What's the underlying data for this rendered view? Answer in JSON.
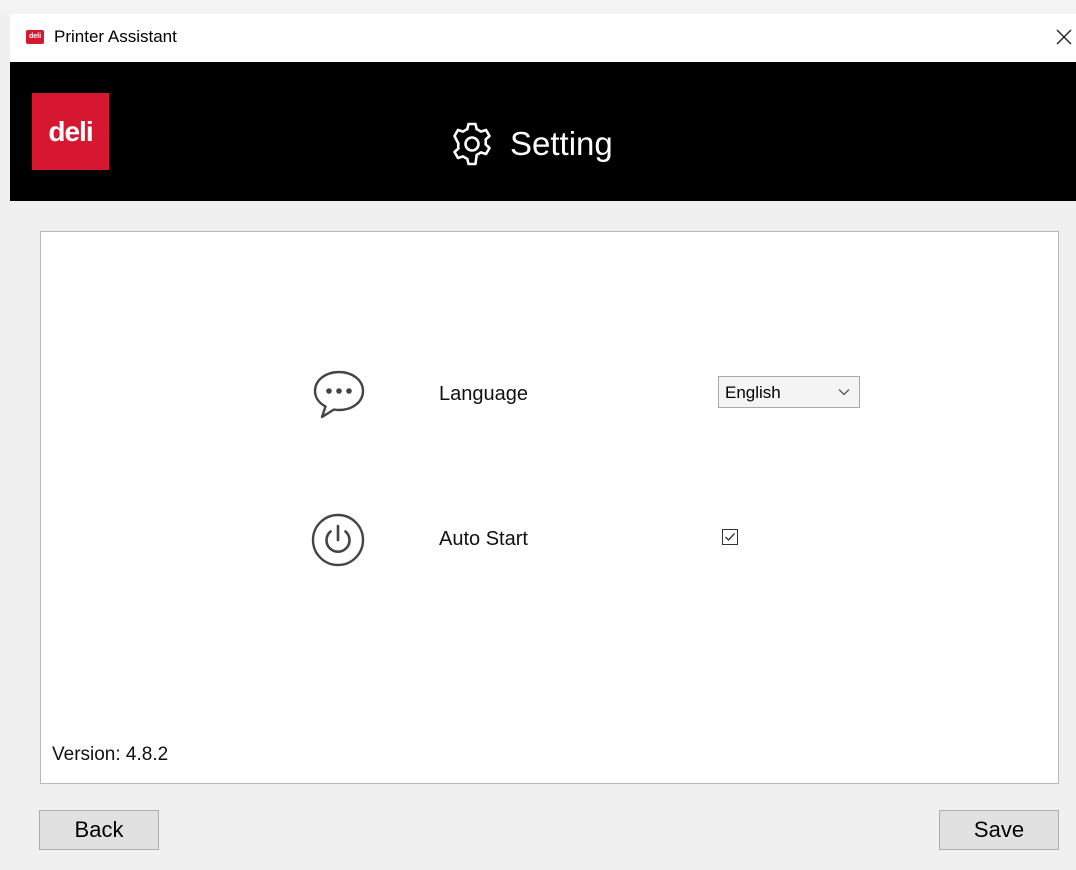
{
  "window": {
    "title": "Printer Assistant",
    "icon_text": "deli",
    "close_symbol": "✕"
  },
  "header": {
    "logo_text": "deli",
    "title": "Setting",
    "icon": "gear-icon",
    "background": "#000000",
    "brand_color": "#d7172f"
  },
  "settings": {
    "language": {
      "icon": "chat-bubble-icon",
      "label": "Language",
      "selected": "English"
    },
    "auto_start": {
      "icon": "power-icon",
      "label": "Auto Start",
      "checked": true
    }
  },
  "footer": {
    "version": "Version: 4.8.2"
  },
  "buttons": {
    "back_label": "Back",
    "save_label": "Save"
  }
}
